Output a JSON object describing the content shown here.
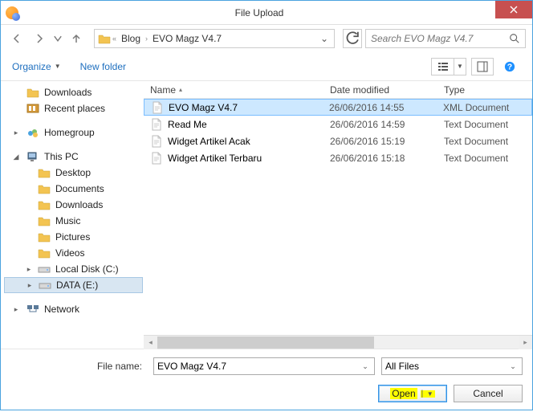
{
  "window": {
    "title": "File Upload"
  },
  "breadcrumb": {
    "sep": "›",
    "items": [
      "Blog",
      "EVO Magz V4.7"
    ]
  },
  "search": {
    "placeholder": "Search EVO Magz V4.7"
  },
  "toolbar": {
    "organize": "Organize",
    "newfolder": "New folder"
  },
  "columns": {
    "name": "Name",
    "date": "Date modified",
    "type": "Type"
  },
  "tree": [
    {
      "id": "downloads-q",
      "label": "Downloads",
      "icon": "folder",
      "depth": 0
    },
    {
      "id": "recent",
      "label": "Recent places",
      "icon": "recent",
      "depth": 0
    },
    {
      "spacer": true
    },
    {
      "id": "homegroup",
      "label": "Homegroup",
      "icon": "homegroup",
      "depth": 0,
      "exp": "▸"
    },
    {
      "spacer": true
    },
    {
      "id": "thispc",
      "label": "This PC",
      "icon": "pc",
      "depth": 0,
      "exp": "◢"
    },
    {
      "id": "desktop",
      "label": "Desktop",
      "icon": "folder",
      "depth": 1
    },
    {
      "id": "documents",
      "label": "Documents",
      "icon": "folder",
      "depth": 1
    },
    {
      "id": "downloads",
      "label": "Downloads",
      "icon": "folder",
      "depth": 1
    },
    {
      "id": "music",
      "label": "Music",
      "icon": "folder",
      "depth": 1
    },
    {
      "id": "pictures",
      "label": "Pictures",
      "icon": "folder",
      "depth": 1
    },
    {
      "id": "videos",
      "label": "Videos",
      "icon": "folder",
      "depth": 1
    },
    {
      "id": "cdrive",
      "label": "Local Disk (C:)",
      "icon": "drive",
      "depth": 1,
      "exp": "▸"
    },
    {
      "id": "edrive",
      "label": "DATA (E:)",
      "icon": "drive",
      "depth": 1,
      "exp": "▸",
      "selected": true
    },
    {
      "spacer": true
    },
    {
      "id": "network",
      "label": "Network",
      "icon": "network",
      "depth": 0,
      "exp": "▸"
    }
  ],
  "files": [
    {
      "name": "EVO Magz V4.7",
      "date": "26/06/2016 14:55",
      "type": "XML Document",
      "selected": true
    },
    {
      "name": "Read Me",
      "date": "26/06/2016 14:59",
      "type": "Text Document"
    },
    {
      "name": "Widget Artikel Acak",
      "date": "26/06/2016 15:19",
      "type": "Text Document"
    },
    {
      "name": "Widget Artikel Terbaru",
      "date": "26/06/2016 15:18",
      "type": "Text Document"
    }
  ],
  "footer": {
    "filename_label": "File name:",
    "filename_value": "EVO Magz V4.7",
    "filter": "All Files",
    "open": "Open",
    "cancel": "Cancel"
  }
}
